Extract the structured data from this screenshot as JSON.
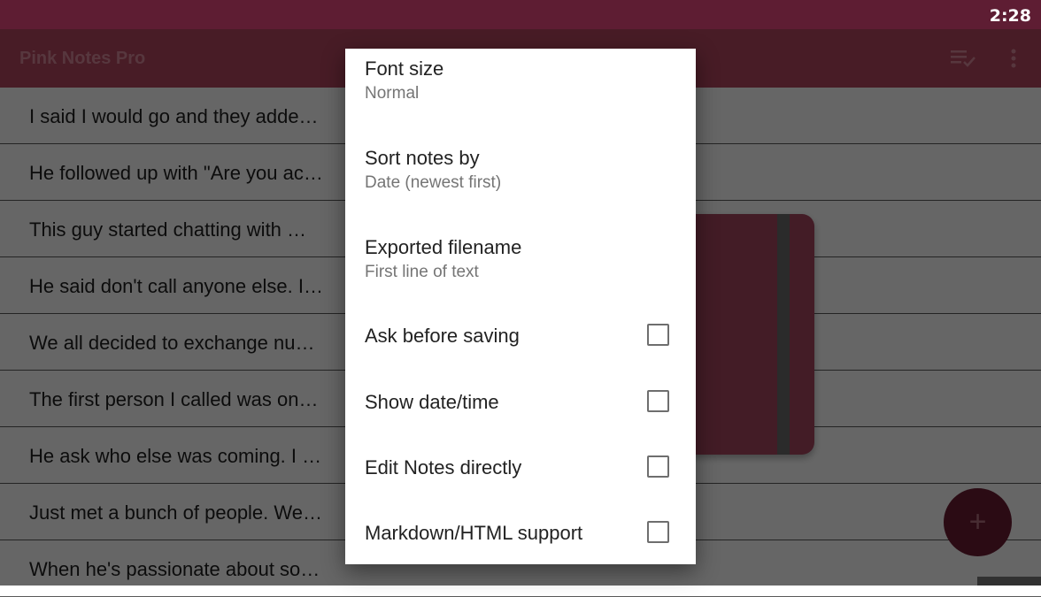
{
  "status_bar": {
    "time": "2:28"
  },
  "app_bar": {
    "title": "Pink Notes Pro",
    "icons": [
      "select-all-icon",
      "more-vert-icon"
    ]
  },
  "notes": [
    "I said I would go and they adde…",
    "He followed up with \"Are you ac…",
    "This guy started chatting with …",
    "He said don't call anyone else. I…",
    "We all decided to exchange nu…",
    "The first person I called was on…",
    "He ask who else was coming. I …",
    "Just met a bunch of people. We…",
    "When he's passionate about so…"
  ],
  "fab": {
    "label": "+",
    "icon": "add-icon"
  },
  "settings": {
    "font_size": {
      "title": "Font size",
      "value": "Normal"
    },
    "sort_notes": {
      "title": "Sort notes by",
      "value": "Date (newest first)"
    },
    "exported_filename": {
      "title": "Exported filename",
      "value": "First line of text"
    },
    "ask_before_saving": {
      "label": "Ask before saving",
      "checked": false
    },
    "show_date_time": {
      "label": "Show date/time",
      "checked": false
    },
    "edit_notes_directly": {
      "label": "Edit Notes directly",
      "checked": false
    },
    "markdown_html": {
      "label": "Markdown/HTML support",
      "checked": false
    }
  },
  "colors": {
    "status_bar": "#5e1d33",
    "app_bar": "#b3475f",
    "accent": "#6c1d33"
  }
}
